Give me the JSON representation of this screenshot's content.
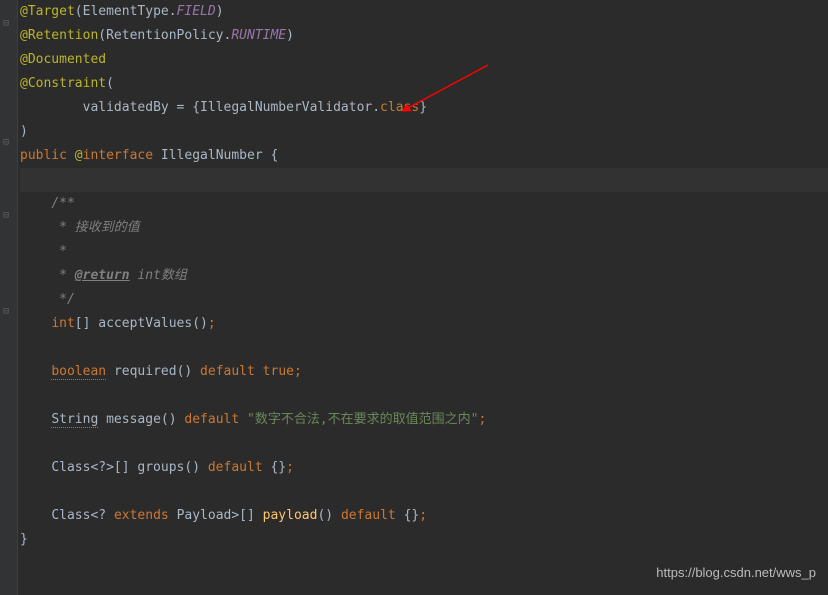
{
  "code": {
    "line1": {
      "at_target": "@Target",
      "paren_open": "(",
      "element_type": "ElementType",
      "dot": ".",
      "field": "FIELD",
      "paren_close": ")"
    },
    "line2": {
      "at_retention": "@Retention",
      "paren_open": "(",
      "retention_policy": "RetentionPolicy",
      "dot": ".",
      "runtime": "RUNTIME",
      "paren_close": ")"
    },
    "line3": {
      "at_documented": "@Documented"
    },
    "line4": {
      "at_constraint": "@Constraint",
      "paren_open": "("
    },
    "line5": {
      "indent": "        ",
      "validated_by": "validatedBy = {",
      "validator_class": "IllegalNumberValidator",
      "dot": ".",
      "class_kw": "class",
      "close_brace": "}"
    },
    "line6": {
      "paren_close": ")"
    },
    "line7": {
      "public_kw": "public ",
      "at": "@",
      "interface_kw": "interface ",
      "name": "IllegalNumber ",
      "brace": "{"
    },
    "line9": {
      "indent": "    ",
      "comment": "/**"
    },
    "line10": {
      "indent": "     ",
      "comment": "* 接收到的值"
    },
    "line11": {
      "indent": "     ",
      "comment": "*"
    },
    "line12": {
      "indent": "     ",
      "star": "* ",
      "return_tag": "@return",
      "desc": " int数组"
    },
    "line13": {
      "indent": "     ",
      "comment": "*/"
    },
    "line14": {
      "indent": "    ",
      "int_kw": "int",
      "brackets": "[] ",
      "method": "acceptValues",
      "parens": "()",
      "semi": ";"
    },
    "line16": {
      "indent": "    ",
      "boolean_kw": "boolean",
      "space": " ",
      "method": "required",
      "parens": "() ",
      "default_kw": "default ",
      "true_kw": "true",
      "semi": ";"
    },
    "line18": {
      "indent": "    ",
      "string_type": "String",
      "space": " ",
      "method": "message",
      "parens": "() ",
      "default_kw": "default ",
      "string_val": "\"数字不合法,不在要求的取值范围之内\"",
      "semi": ";"
    },
    "line20": {
      "indent": "    ",
      "class_part": "Class<?>[] ",
      "method": "groups",
      "parens": "() ",
      "default_kw": "default ",
      "braces": "{}",
      "semi": ";"
    },
    "line22": {
      "indent": "    ",
      "class_part1": "Class<? ",
      "extends_kw": "extends ",
      "payload": "Payload>[] ",
      "method": "payload",
      "parens": "() ",
      "default_kw": "default ",
      "braces": "{}",
      "semi": ";"
    },
    "line23": {
      "brace": "}"
    }
  },
  "gutter_icons": {
    "collapse1": "⊟",
    "collapse2": "⊟",
    "collapse3": "⊟",
    "collapse4": "⊟"
  },
  "watermark": "https://blog.csdn.net/wws_p"
}
